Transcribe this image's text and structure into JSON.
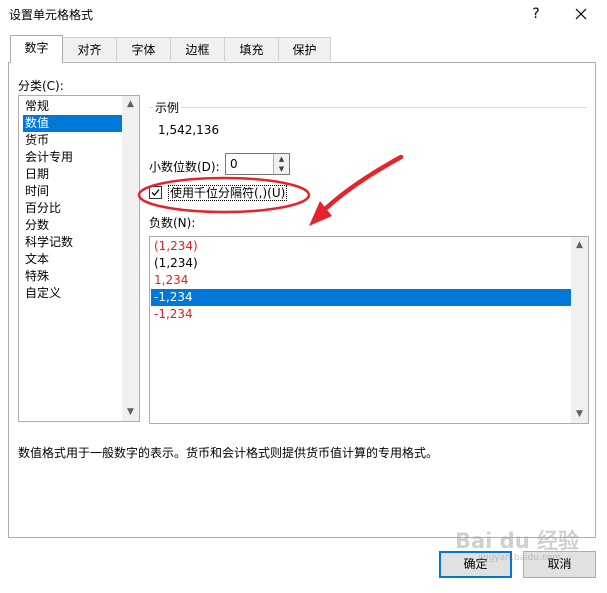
{
  "window": {
    "title": "设置单元格格式",
    "help": "?",
    "close": "✕"
  },
  "tabs": [
    {
      "label": "数字",
      "active": true
    },
    {
      "label": "对齐"
    },
    {
      "label": "字体"
    },
    {
      "label": "边框"
    },
    {
      "label": "填充"
    },
    {
      "label": "保护"
    }
  ],
  "category": {
    "label": "分类(C):",
    "items": [
      "常规",
      "数值",
      "货币",
      "会计专用",
      "日期",
      "时间",
      "百分比",
      "分数",
      "科学记数",
      "文本",
      "特殊",
      "自定义"
    ],
    "selected": "数值"
  },
  "sample": {
    "label": "示例",
    "value": "1,542,136"
  },
  "decimals": {
    "label": "小数位数(D):",
    "value": "0"
  },
  "thousands_separator": {
    "label": "使用千位分隔符(,)(U)",
    "checked": true
  },
  "negative_numbers": {
    "label": "负数(N):",
    "items": [
      "(1,234)",
      "(1,234)",
      "1,234",
      "-1,234",
      "-1,234"
    ],
    "selected_index": 3
  },
  "description": "数值格式用于一般数字的表示。货币和会计格式则提供货币值计算的专用格式。",
  "buttons": {
    "ok": "确定",
    "cancel": "取消"
  },
  "watermark": {
    "text": "Bai du 经验",
    "sub": "jingyan.baidu.com"
  },
  "colors": {
    "selection": "#0078d7",
    "negative_red": "#e81c1c",
    "annotation_red": "#e5232b"
  }
}
